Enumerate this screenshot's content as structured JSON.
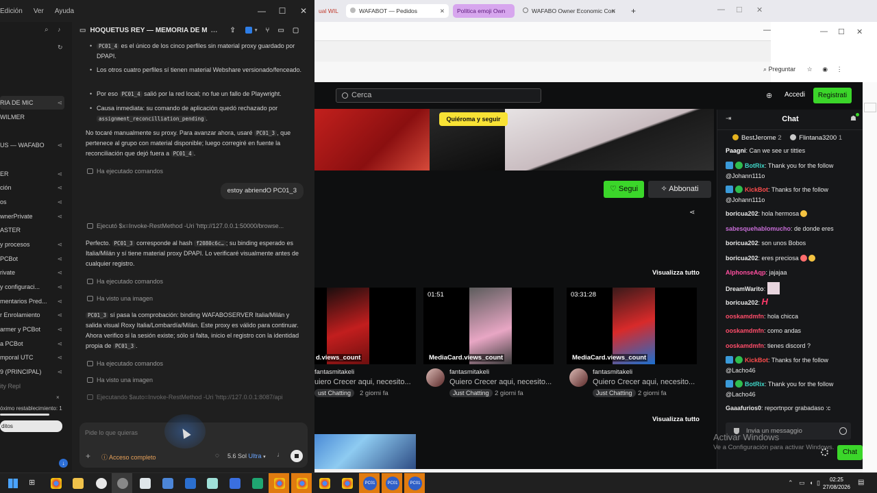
{
  "menubar": {
    "items": [
      "Edición",
      "Ver",
      "Ayuda"
    ]
  },
  "left_window_controls": {
    "minimize": "—",
    "maximize": "☐",
    "close": "✕"
  },
  "sidebar": {
    "items": [
      {
        "label": "RIA DE MIC"
      },
      {
        "label": "WILMER"
      },
      {
        "label": "US — WAFABO"
      },
      {
        "label": "ER"
      },
      {
        "label": "ción"
      },
      {
        "label": "os"
      },
      {
        "label": "wnerPrivate"
      },
      {
        "label": "ASTER"
      },
      {
        "label": "y procesos"
      },
      {
        "label": "PCBot"
      },
      {
        "label": "rivate"
      },
      {
        "label": "y configuraci..."
      },
      {
        "label": "mentarios Pred..."
      },
      {
        "label": "r Enrolamiento"
      },
      {
        "label": "armer y PCBot"
      },
      {
        "label": "a PCBot"
      },
      {
        "label": "mporal UTC"
      },
      {
        "label": "9 (PRINCIPAL)"
      },
      {
        "label": "ity Repl"
      }
    ],
    "toast_text": "óximo restablecimiento: 1",
    "toast_button": "ditos"
  },
  "conversation": {
    "title": "HOQUETUS REY — MEMORIA DE MIGR",
    "bullet1_code": "PC01_4",
    "bullet1_text": "es el único de los cinco perfiles sin material proxy guardado por DPAPI.",
    "bullet2_text": "Los otros cuatro perfiles sí tienen material Webshare versionado/fenceado.",
    "bullet3_pre": "Por eso",
    "bullet3_code": "PC01_4",
    "bullet3_post": "salió por la red local; no fue un fallo de Playwright.",
    "bullet4_text": "Causa inmediata: su comando de aplicación quedó rechazado por",
    "bullet4_code": "assignment_reconcilliation_pending",
    "para1_a": "No tocaré manualmente su proxy. Para avanzar ahora, usaré",
    "para1_code1": "PC01_3",
    "para1_b": ", que pertenece al grupo con material disponible; luego corregiré en fuente la reconciliación que dejó fuera a",
    "para1_code2": "PC01_4",
    "cmd1": "Ha ejecutado comandos",
    "user_msg": "estoy abriendO PC01_3",
    "cmd2": "Ejecutó $x=Invoke-RestMethod -Uri 'http://127.0.0.1:50000/browse...",
    "para2_a": "Perfecto.",
    "para2_code1": "PC01_3",
    "para2_b": "corresponde al hash",
    "para2_code2": "f2080c6c…",
    "para2_c": "; su binding esperado es Italia/Milán y sí tiene material proxy DPAPI. Lo verificaré visualmente antes de cualquier registro.",
    "cmd3": "Ha ejecutado comandos",
    "cmd4": "Ha visto una imagen",
    "para3_code1": "PC01_3",
    "para3_a": "sí pasa la comprobación: binding WAFABOSERVER Italia/Milán y salida visual Roxy Italia/Lombardía/Milán. Este proxy es válido para continuar. Ahora verifico si la sesión existe; sólo si falta, inicio el registro con la identidad propia de",
    "para3_code2": "PC01_3",
    "cmd5": "Ha ejecutado comandos",
    "cmd6": "Ha visto una imagen",
    "cmd7": "Ejecutando $auto=Invoke-RestMethod -Uri 'http://127.0.0.1:8087/api"
  },
  "composer": {
    "placeholder": "Pide lo que quieras",
    "access": "Acceso completo",
    "model": "5.6 Sol",
    "model_mode": "Ultra"
  },
  "browser": {
    "tabs": [
      {
        "label": "ual WIL"
      },
      {
        "label": "WAFABOT — Pedidos"
      },
      {
        "label": "Política emoji Own"
      },
      {
        "label": "WAFABO Owner Economic Con"
      }
    ],
    "pregunta": "Preguntar"
  },
  "site": {
    "search_placeholder": "Cerca",
    "login": "Accedi",
    "register": "Registrati",
    "banner_sticker": "Quiéroma y seguir",
    "follow": "Segui",
    "subscribe": "Abbonati",
    "view_all": "Visualizza tutto",
    "videos": [
      {
        "duration": "",
        "views": "d.views_count",
        "channel": "fantasmitakeli",
        "title": "uiero Crecer aqui, necesito...",
        "tag": "ust Chatting",
        "ago": "2 giorni fa"
      },
      {
        "duration": "01:51",
        "views": "MediaCard.views_count",
        "channel": "fantasmitakeli",
        "title": "Quiero Crecer aqui, necesito...",
        "tag": "Just Chatting",
        "ago": "2 giorni fa"
      },
      {
        "duration": "03:31:28",
        "views": "MediaCard.views_count",
        "channel": "fantasmitakeli",
        "title": "Quiero Crecer aqui, necesito...",
        "tag": "Just Chatting",
        "ago": "2 giorni fa"
      }
    ]
  },
  "chat": {
    "title": "Chat",
    "gifters": [
      {
        "name": "BestJerome",
        "count": "2"
      },
      {
        "name": "Flintana3200",
        "count": "1"
      }
    ],
    "messages": [
      {
        "user": "Paagni",
        "text": "Can we see ur titties",
        "color": "#ffffff",
        "badges": false
      },
      {
        "user": "BotRix",
        "text": "Thank you for the follow @Johann111o",
        "color": "#3fd6c7",
        "badges": true
      },
      {
        "user": "KickBot",
        "text": "Thanks for the follow @Johann111o",
        "color": "#ff4d4d",
        "badges": true
      },
      {
        "user": "boricua202",
        "text": "hola hermosa",
        "color": "#ffffff",
        "badges": false
      },
      {
        "user": "sabesquehablomucho",
        "text": "de donde eres",
        "color": "#c86dd7",
        "badges": false
      },
      {
        "user": "boricua202",
        "text": "son unos Bobos",
        "color": "#ffffff",
        "badges": false
      },
      {
        "user": "boricua202",
        "text": "eres preciosa",
        "color": "#ffffff",
        "badges": false
      },
      {
        "user": "AlphonseAqp",
        "text": "jajajaa",
        "color": "#ff4fa0",
        "badges": false
      },
      {
        "user": "DreamWarito",
        "text": "",
        "color": "#ffffff",
        "badges": false
      },
      {
        "user": "boricua202",
        "text": "",
        "color": "#ffffff",
        "badges": false
      },
      {
        "user": "ooskamdmfn",
        "text": "hola chicca",
        "color": "#ff4d6a",
        "badges": false
      },
      {
        "user": "ooskamdmfn",
        "text": "como andas",
        "color": "#ff4d6a",
        "badges": false
      },
      {
        "user": "ooskamdmfn",
        "text": "tienes discord ?",
        "color": "#ff4d6a",
        "badges": false
      },
      {
        "user": "KickBot",
        "text": "Thanks for the follow @Lacho46",
        "color": "#ff4d4d",
        "badges": true
      },
      {
        "user": "BotRix",
        "text": "Thank you for the follow @Lacho46",
        "color": "#3fd6c7",
        "badges": true
      },
      {
        "user": "Gaaafurios0",
        "text": "reportnpor grabadaso :c",
        "color": "#ffffff",
        "badges": false
      }
    ],
    "input_placeholder": "Invia un messaggio",
    "send": "Chat"
  },
  "windows_watermark": {
    "line1": "Activar Windows",
    "line2": "Ve a Configuración para activar Windows."
  },
  "taskbar": {
    "time": "02:25",
    "date": "27/08/2026",
    "pc_labels": [
      "PC01",
      "PC01",
      "PC01"
    ]
  }
}
